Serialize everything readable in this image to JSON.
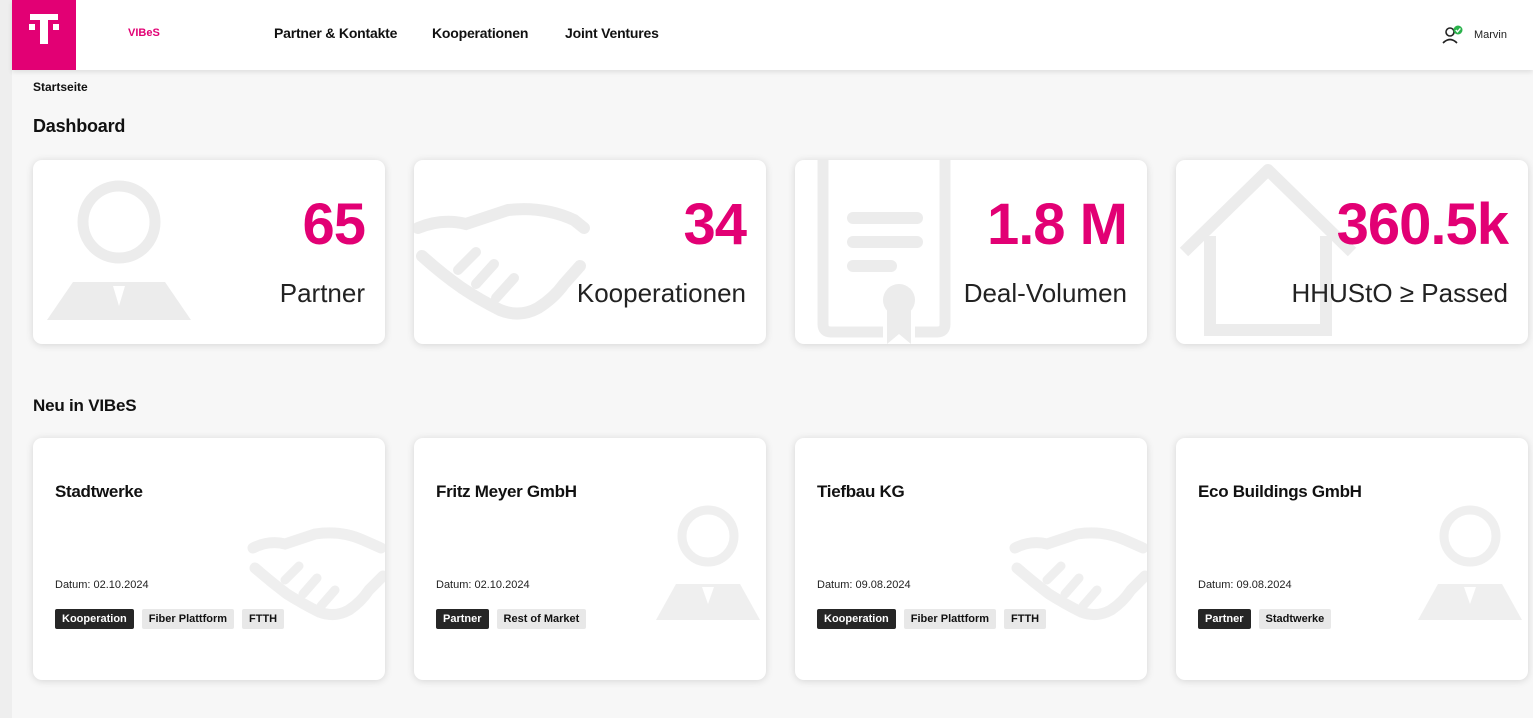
{
  "nav": {
    "brand": "VIBeS",
    "links": [
      "Partner & Kontakte",
      "Kooperationen",
      "Joint Ventures"
    ],
    "user_name": "Marvin"
  },
  "breadcrumb": "Startseite",
  "dashboard": {
    "title": "Dashboard",
    "stats": [
      {
        "value": "65",
        "label": "Partner",
        "icon": "person-icon"
      },
      {
        "value": "34",
        "label": "Kooperationen",
        "icon": "handshake-icon"
      },
      {
        "value": "1.8 M",
        "label": "Deal-Volumen",
        "icon": "document-certificate-icon"
      },
      {
        "value": "360.5k",
        "label": "HHUStO ≥ Passed",
        "icon": "house-icon"
      }
    ]
  },
  "new_section": {
    "title": "Neu in VIBeS",
    "items": [
      {
        "name": "Stadtwerke",
        "date": "Datum: 02.10.2024",
        "tags": [
          "Kooperation",
          "Fiber Plattform",
          "FTTH"
        ],
        "icon": "handshake-icon"
      },
      {
        "name": "Fritz Meyer GmbH",
        "date": "Datum: 02.10.2024",
        "tags": [
          "Partner",
          "Rest of Market"
        ],
        "icon": "person-icon"
      },
      {
        "name": "Tiefbau KG",
        "date": "Datum: 09.08.2024",
        "tags": [
          "Kooperation",
          "Fiber Plattform",
          "FTTH"
        ],
        "icon": "handshake-icon"
      },
      {
        "name": "Eco Buildings GmbH",
        "date": "Datum: 09.08.2024",
        "tags": [
          "Partner",
          "Stadtwerke"
        ],
        "icon": "person-icon"
      }
    ]
  },
  "colors": {
    "brand_magenta": "#e20074",
    "tag_dark": "#262626",
    "tag_light": "#e8e8e8",
    "status_green": "#2bb24c"
  }
}
